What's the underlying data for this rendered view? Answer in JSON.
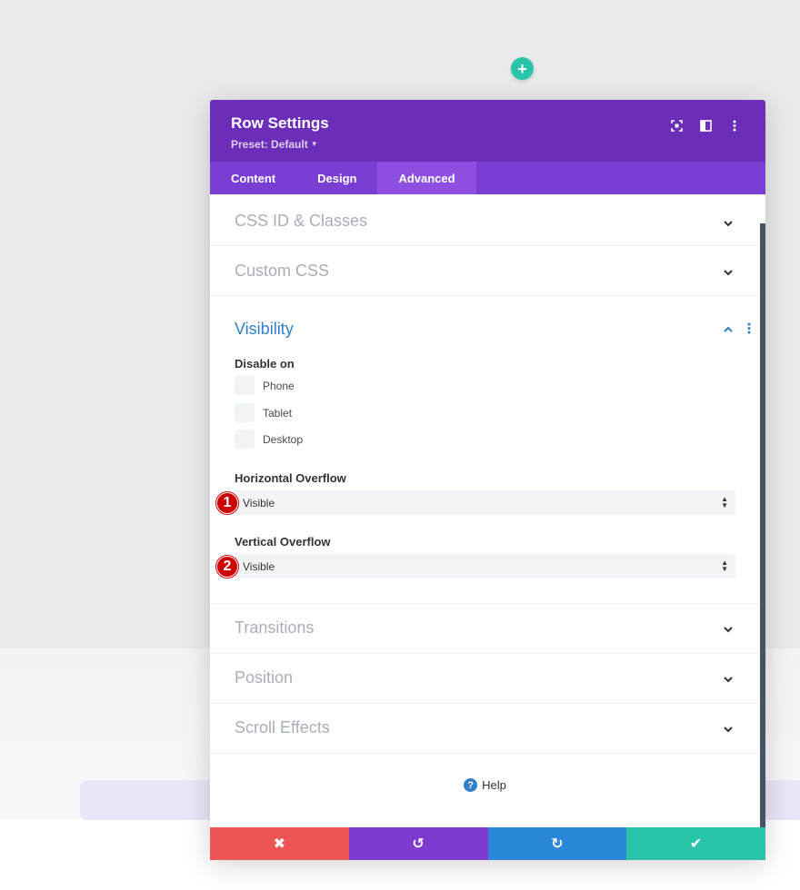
{
  "add_button": {
    "icon": "plus-icon",
    "glyph": "+"
  },
  "modal": {
    "title": "Row Settings",
    "preset": "Preset: Default",
    "header_icons": [
      "fullscreen-icon",
      "split-view-icon",
      "more-options-icon"
    ],
    "tabs": [
      {
        "label": "Content",
        "active": false
      },
      {
        "label": "Design",
        "active": false
      },
      {
        "label": "Advanced",
        "active": true
      }
    ],
    "sections": {
      "css_id": "CSS ID & Classes",
      "custom_css": "Custom CSS",
      "visibility": "Visibility",
      "transitions": "Transitions",
      "position": "Position",
      "scroll_effects": "Scroll Effects"
    },
    "visibility": {
      "disable_on_label": "Disable on",
      "devices": [
        "Phone",
        "Tablet",
        "Desktop"
      ],
      "h_overflow_label": "Horizontal Overflow",
      "h_overflow_value": "Visible",
      "v_overflow_label": "Vertical Overflow",
      "v_overflow_value": "Visible"
    },
    "markers": [
      "1",
      "2"
    ],
    "help": "Help",
    "help_glyph": "?",
    "footer": {
      "cancel": "✖",
      "undo": "↺",
      "redo": "↻",
      "save": "✔"
    }
  },
  "colors": {
    "header": "#6c2eb9",
    "tabs": "#7b3ed2",
    "active_tab": "#8e4fe0",
    "accent_teal": "#29c4a9",
    "cancel": "#ef5555",
    "undo": "#7e3bd0",
    "redo": "#2b87da",
    "save": "#29c4a9",
    "marker": "#cc0000"
  }
}
